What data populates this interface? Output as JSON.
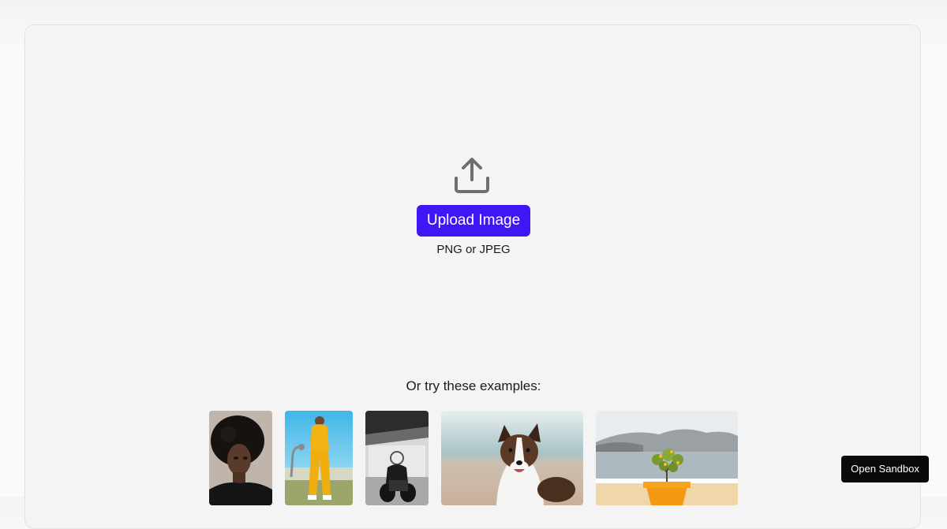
{
  "upload": {
    "icon": "upload-tray-icon",
    "button_label": "Upload Image",
    "formats": "PNG or JPEG",
    "accent_color": "#4116f5"
  },
  "examples": {
    "title": "Or try these examples:",
    "items": [
      {
        "subject": "portrait-woman-afro-icon"
      },
      {
        "subject": "person-yellow-outfit-icon"
      },
      {
        "subject": "motorcycle-rider-icon"
      },
      {
        "subject": "dog-on-beach-icon"
      },
      {
        "subject": "potted-plant-sea-view-icon"
      }
    ]
  },
  "sandbox": {
    "button_label": "Open Sandbox"
  }
}
